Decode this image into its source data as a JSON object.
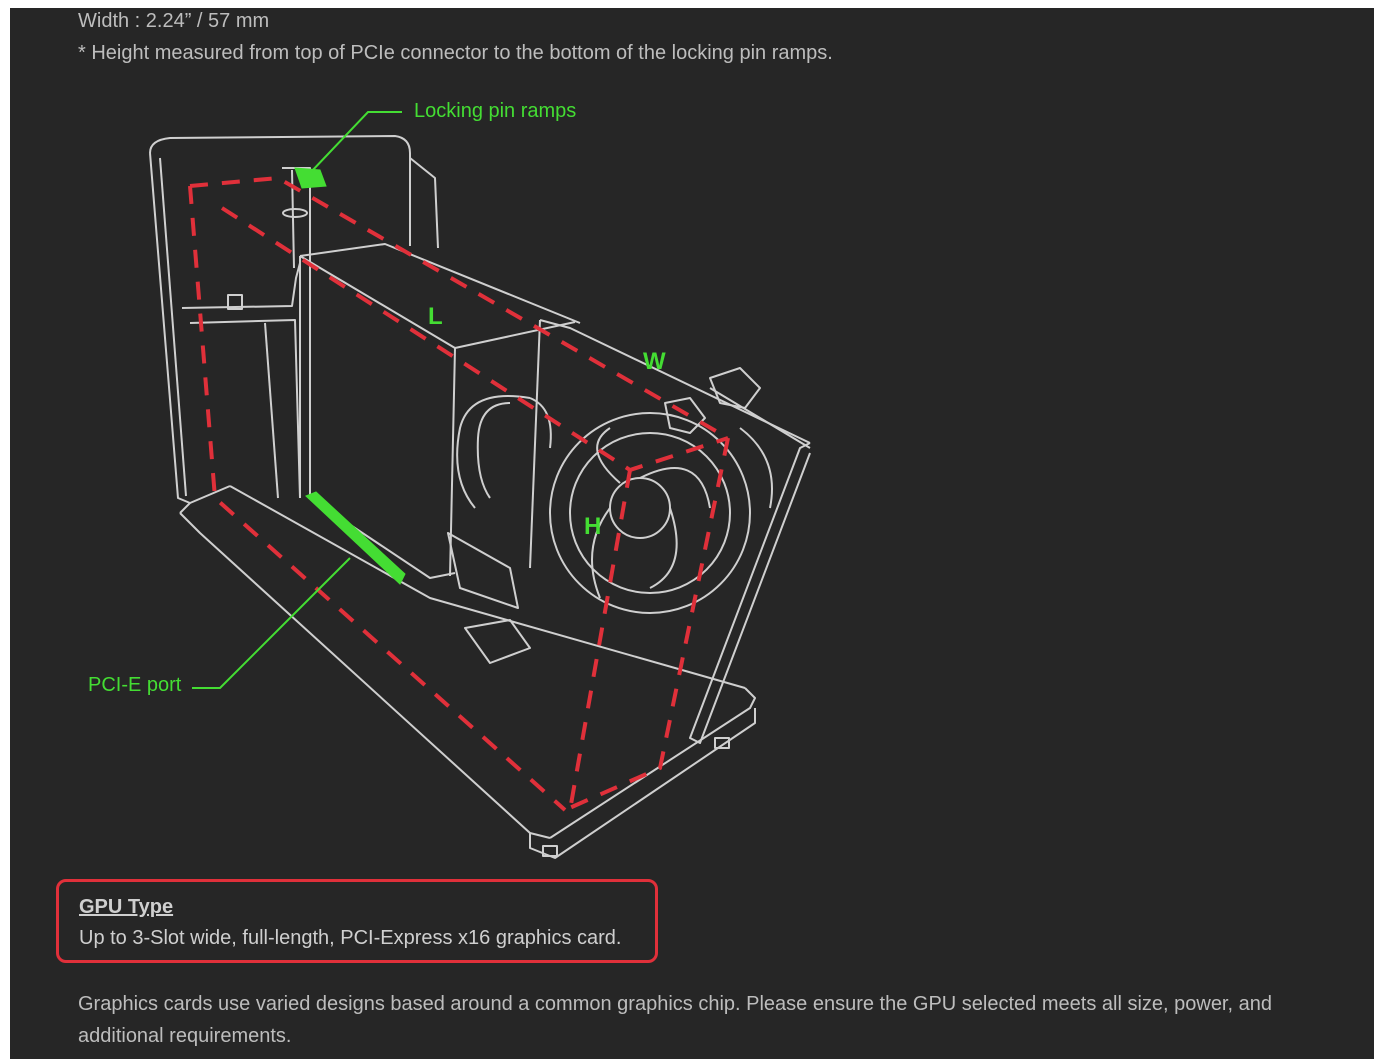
{
  "specs": {
    "width_line": "Width : 2.24” / 57 mm",
    "height_note": "* Height measured from top of PCIe connector to the bottom of the locking pin ramps."
  },
  "diagram": {
    "callouts": {
      "locking_pin_ramps": "Locking pin ramps",
      "pcie_port": "PCI-E port"
    },
    "dimensions": {
      "length": "L",
      "width": "W",
      "height": "H"
    },
    "colors": {
      "highlight": "#44dd33",
      "dimension_lines": "#e0303a",
      "outline": "#cfcfcf"
    }
  },
  "gpu_type": {
    "title": "GPU Type",
    "description": "Up to 3-Slot wide, full-length, PCI-Express x16 graphics card."
  },
  "note": "Graphics cards use varied designs based around a common graphics chip. Please ensure the GPU selected meets all size, power, and additional requirements."
}
